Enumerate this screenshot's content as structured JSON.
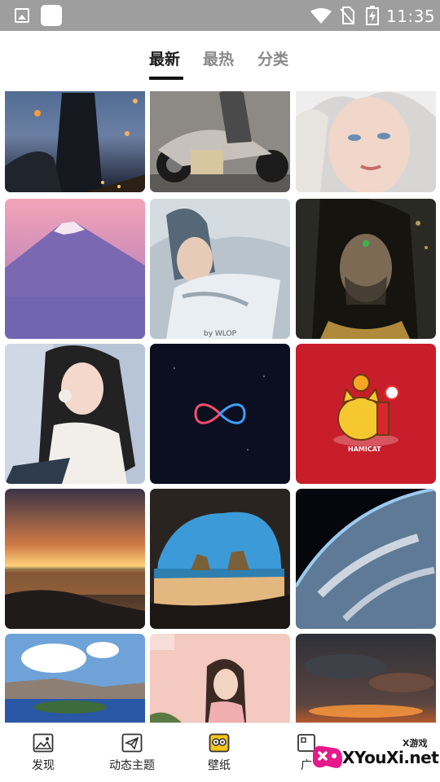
{
  "status_bar": {
    "time": "11:35",
    "icons": [
      "image-icon",
      "app-square-icon",
      "wifi-icon",
      "no-sim-icon",
      "battery-charging-icon"
    ]
  },
  "tabs": [
    {
      "label": "最新",
      "active": true
    },
    {
      "label": "最热",
      "active": false
    },
    {
      "label": "分类",
      "active": false
    }
  ],
  "wallpapers": [
    {
      "name": "wallpaper-warrior-lanterns"
    },
    {
      "name": "wallpaper-motorcycle-rider"
    },
    {
      "name": "wallpaper-silver-hair-girl"
    },
    {
      "name": "wallpaper-mount-fuji-pink"
    },
    {
      "name": "wallpaper-elf-girl-painting",
      "caption": "by WLOP"
    },
    {
      "name": "wallpaper-veiled-woman"
    },
    {
      "name": "wallpaper-girl-portrait"
    },
    {
      "name": "wallpaper-neon-infinity"
    },
    {
      "name": "wallpaper-hamicat",
      "caption": "HAMICAT"
    },
    {
      "name": "wallpaper-sunset-lake"
    },
    {
      "name": "wallpaper-sea-cave-beach"
    },
    {
      "name": "wallpaper-earth-from-space"
    },
    {
      "name": "wallpaper-crater-lake"
    },
    {
      "name": "wallpaper-girl-pink-room"
    },
    {
      "name": "wallpaper-fiery-clouds"
    }
  ],
  "bottom_nav": [
    {
      "label": "发现",
      "icon": "image-icon"
    },
    {
      "label": "动态主题",
      "icon": "paper-plane-icon"
    },
    {
      "label": "壁纸",
      "icon": "face-icon",
      "accent": "#f5c518"
    },
    {
      "label": "广",
      "icon": "grid-icon"
    }
  ],
  "watermark": {
    "text": "XYouXi.net",
    "small": "X游戏"
  }
}
